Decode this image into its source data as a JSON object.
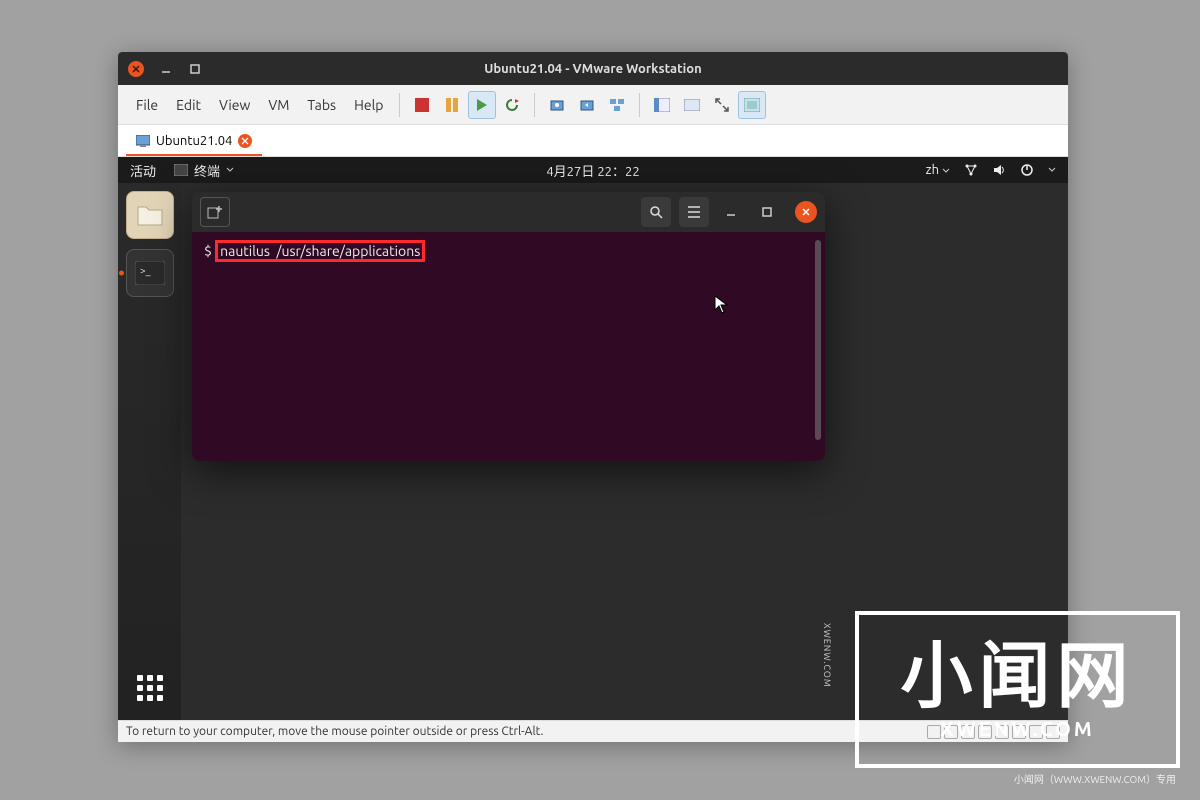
{
  "vmware": {
    "title": "Ubuntu21.04 - VMware Workstation",
    "menus": [
      "File",
      "Edit",
      "View",
      "VM",
      "Tabs",
      "Help"
    ],
    "tab_label": "Ubuntu21.04",
    "status_text": "To return to your computer, move the mouse pointer outside or press Ctrl-Alt."
  },
  "gnome": {
    "activities": "活动",
    "app_label": "终端",
    "datetime": "4月27日  22：22",
    "lang_indicator": "zh"
  },
  "terminal": {
    "prompt": "$",
    "command": "nautilus  /usr/share/applications"
  },
  "watermark": {
    "cn": "小闻网",
    "en": "XWENW.COM",
    "side": "XWENW.COM",
    "small": "小闻网（WWW.XWENW.COM）专用"
  }
}
